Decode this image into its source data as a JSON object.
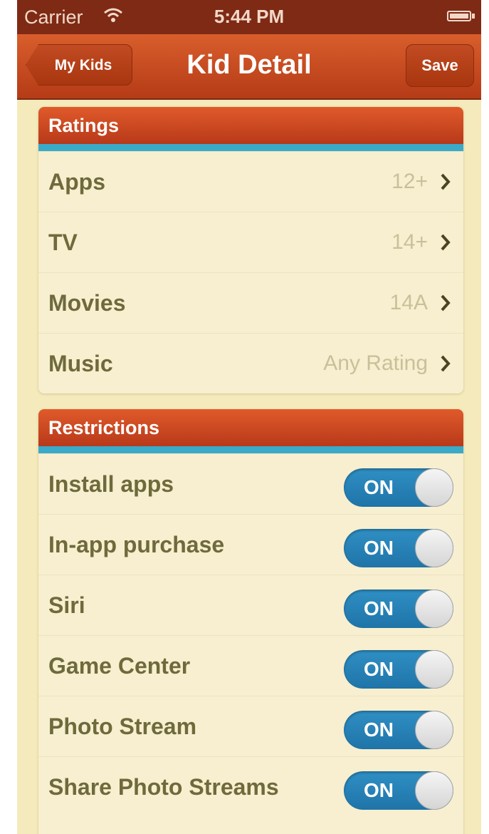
{
  "status_bar": {
    "carrier": "Carrier",
    "time": "5:44 PM"
  },
  "navbar": {
    "back_label": "My Kids",
    "title": "Kid Detail",
    "save_label": "Save"
  },
  "ratings": {
    "header": "Ratings",
    "items": [
      {
        "label": "Apps",
        "value": "12+"
      },
      {
        "label": "TV",
        "value": "14+"
      },
      {
        "label": "Movies",
        "value": "14A"
      },
      {
        "label": "Music",
        "value": "Any Rating"
      }
    ]
  },
  "restrictions": {
    "header": "Restrictions",
    "toggle_text": "ON",
    "items": [
      {
        "label": "Install apps",
        "state": "ON"
      },
      {
        "label": "In-app purchase",
        "state": "ON"
      },
      {
        "label": "Siri",
        "state": "ON"
      },
      {
        "label": "Game Center",
        "state": "ON"
      },
      {
        "label": "Photo Stream",
        "state": "ON"
      },
      {
        "label": "Share Photo Streams",
        "state": "ON"
      }
    ]
  },
  "colors": {
    "accent_blue": "#3aaac9",
    "header_orange": "#d2481f",
    "background": "#f4eabb"
  }
}
